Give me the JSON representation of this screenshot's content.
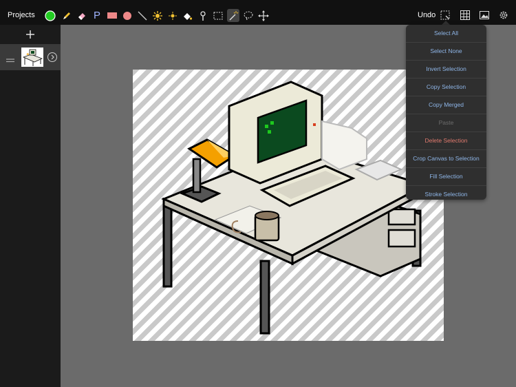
{
  "toolbar": {
    "projects_label": "Projects",
    "undo_label": "Undo",
    "primary_color": "#22cc22",
    "secondary_color": "#ee8888",
    "text_tool_glyph": "P",
    "tools": [
      "color-swatch",
      "pencil-icon",
      "eraser-icon",
      "text-icon",
      "rectangle-icon",
      "ellipse-icon",
      "line-icon",
      "sun-brush-icon",
      "small-sun-brush-icon",
      "fill-bucket-icon",
      "eyedropper-icon",
      "marquee-select-icon",
      "magic-wand-icon",
      "lasso-icon",
      "move-icon"
    ],
    "right_tools": [
      "selection-menu-icon",
      "grid-icon",
      "image-icon",
      "gear-icon"
    ]
  },
  "sidebar": {
    "add_layer_icon": "plus-icon",
    "layer": {
      "thumbnail": "desk-computer-thumbnail",
      "handle": "drag-handle-icon",
      "arrow": "chevron-right-icon"
    }
  },
  "selection_menu": {
    "items": [
      {
        "label": "Select All",
        "state": "normal"
      },
      {
        "label": "Select None",
        "state": "normal"
      },
      {
        "label": "Invert Selection",
        "state": "normal"
      },
      {
        "label": "Copy Selection",
        "state": "normal"
      },
      {
        "label": "Copy Merged",
        "state": "normal"
      },
      {
        "label": "Paste",
        "state": "disabled"
      },
      {
        "label": "Delete Selection",
        "state": "danger"
      },
      {
        "label": "Crop Canvas to Selection",
        "state": "normal"
      },
      {
        "label": "Fill Selection",
        "state": "normal"
      },
      {
        "label": "Stroke Selection",
        "state": "normal"
      }
    ]
  },
  "canvas": {
    "artwork": "pixel-art-computer-desk"
  }
}
